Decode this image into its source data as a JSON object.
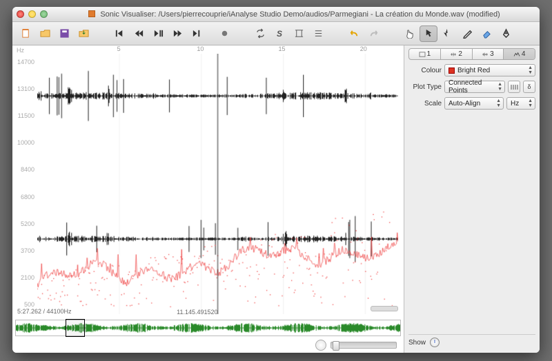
{
  "title": "Sonic Visualiser: /Users/pierrecouprie/iAnalyse Studio Demo/audios/Parmegiani - La création du Monde.wav (modified)",
  "status_left": "5:27.262 / 44100Hz",
  "status_center": "11.145.491520",
  "yaxis": {
    "unit": "Hz",
    "ticks": [
      14700,
      13100,
      11500,
      10000,
      8400,
      6800,
      5200,
      3700,
      2100,
      500
    ]
  },
  "xaxis": {
    "ticks": [
      5,
      10,
      15,
      20
    ]
  },
  "tabs": [
    {
      "key": "1",
      "label": "1"
    },
    {
      "key": "2",
      "label": "2"
    },
    {
      "key": "3",
      "label": "3"
    },
    {
      "key": "4",
      "label": "4",
      "active": true
    }
  ],
  "panel": {
    "colour_label": "Colour",
    "colour_value": "Bright Red",
    "plot_label": "Plot Type",
    "plot_value": "Connected Points",
    "scale_label": "Scale",
    "scale_value": "Auto-Align",
    "scale_unit": "Hz"
  },
  "show_label": "Show",
  "delta_label": "δ",
  "overview_window": {
    "left_pct": 13,
    "width_pct": 5
  }
}
